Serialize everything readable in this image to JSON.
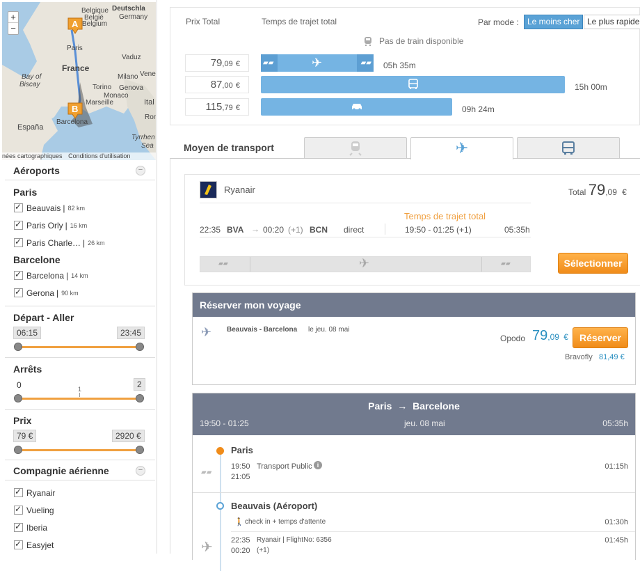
{
  "map": {
    "labels": [
      "Belgique",
      "België",
      "Belgium",
      "Deutschla",
      "Germany",
      "Paris",
      "France",
      "Vaduz",
      "Bay of",
      "Biscay",
      "Milano",
      "Venezia",
      "Torino",
      "Genova",
      "Monaco",
      "Marseille",
      "Ital",
      "España",
      "Barcelona",
      "Tyrrhen",
      "Sea",
      "Rom"
    ],
    "footer_left": "nées cartographiques",
    "footer_right": "Conditions d'utilisation",
    "marker_a": "A",
    "marker_b": "B",
    "zoom_in": "+",
    "zoom_out": "−"
  },
  "filters": {
    "airports": {
      "title": "Aéroports",
      "groups": [
        {
          "city": "Paris",
          "items": [
            {
              "name": "Beauvais",
              "dist": "82 km"
            },
            {
              "name": "Paris Orly",
              "dist": "16 km"
            },
            {
              "name": "Paris Charle…",
              "dist": "26 km"
            }
          ]
        },
        {
          "city": "Barcelone",
          "items": [
            {
              "name": "Barcelona",
              "dist": "14 km"
            },
            {
              "name": "Gerona",
              "dist": "90 km"
            }
          ]
        }
      ]
    },
    "departure": {
      "title": "Départ - Aller",
      "min": "06:15",
      "max": "23:45"
    },
    "stops": {
      "title": "Arrêts",
      "min": "0",
      "mid": "1",
      "max": "2"
    },
    "price": {
      "title": "Prix",
      "min": "79 €",
      "max": "2920 €"
    },
    "airline": {
      "title": "Compagnie aérienne",
      "items": [
        "Ryanair",
        "Vueling",
        "Iberia",
        "Easyjet"
      ]
    }
  },
  "overview": {
    "col_price": "Prix Total",
    "col_time": "Temps de trajet total",
    "mode_label": "Par mode :",
    "mode_cheap": "Le moins cher",
    "mode_fast": "Le plus rapide",
    "no_train": "Pas de train disponible",
    "rows": [
      {
        "int": "79",
        "dec": ",09",
        "cur": "€",
        "duration": "05h 35m",
        "bar_fraction": 0.37
      },
      {
        "int": "87",
        "dec": ",00",
        "cur": "€",
        "duration": "15h 00m",
        "bar_fraction": 1.0
      },
      {
        "int": "115",
        "dec": ",79",
        "cur": "€",
        "duration": "09h 24m",
        "bar_fraction": 0.63
      }
    ]
  },
  "transport": {
    "label": "Moyen de transport"
  },
  "result": {
    "airline": "Ryanair",
    "total_label": "Total",
    "total_int": "79",
    "total_dec": ",09",
    "total_cur": "€",
    "dep_time": "22:35",
    "dep_code": "BVA",
    "arr_time": "00:20",
    "arr_offset": "(+1)",
    "arr_code": "BCN",
    "stops": "direct",
    "total_time_label": "Temps de trajet total",
    "total_range": "19:50 - 01:25 (+1)",
    "total_duration": "05:35h",
    "select_label": "Sélectionner"
  },
  "booking": {
    "title": "Réserver mon voyage",
    "route": "Beauvais - Barcelona",
    "date": "le jeu. 08 mai",
    "provider": "Opodo",
    "price_int": "79",
    "price_dec": ",09",
    "price_cur": "€",
    "book_label": "Réserver",
    "alt_provider": "Bravofly",
    "alt_price": "81,49 €"
  },
  "itinerary": {
    "from": "Paris",
    "to": "Barcelone",
    "arrow": "→",
    "time_range": "19:50 - 01:25",
    "date": "jeu. 08 mai",
    "duration": "05:35h",
    "stop1": {
      "name": "Paris",
      "t1": "19:50",
      "t2": "21:05",
      "desc": "Transport Public",
      "dur": "01:15h"
    },
    "stop2": {
      "name": "Beauvais (Aéroport)",
      "checkin": "check in + temps d'attente",
      "checkin_dur": "01:30h",
      "t1": "22:35",
      "t2": "00:20",
      "offset": "(+1)",
      "flight": "Ryanair | FlightNo: 6356",
      "dur": "01:45h"
    }
  },
  "colors": {
    "accent": "#75b4e3",
    "orange": "#f0a040",
    "header": "#717a8e",
    "price_blue": "#2a8fc0"
  }
}
